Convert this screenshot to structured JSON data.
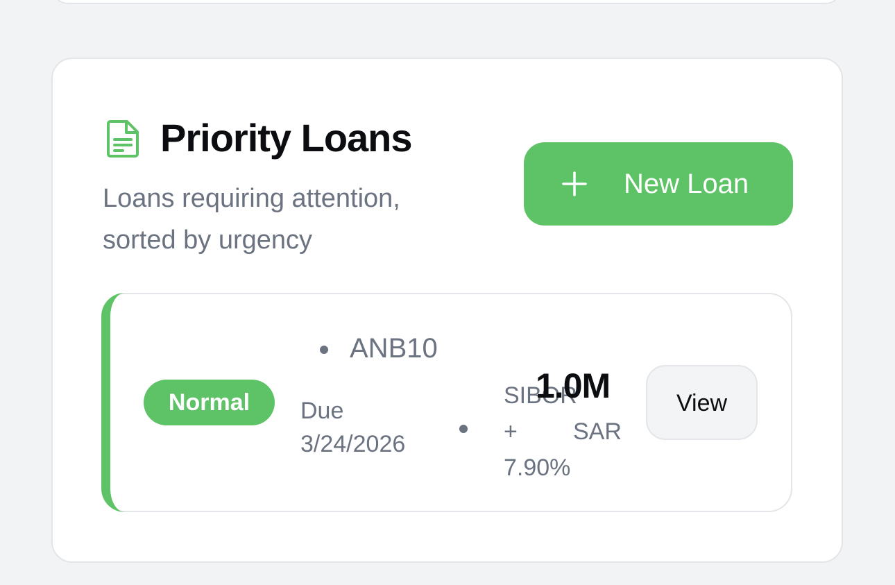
{
  "section": {
    "title": "Priority Loans",
    "subtitle": "Loans requiring attention, sorted by urgency",
    "icon": "document-icon",
    "new_loan_button": {
      "icon": "plus-icon",
      "label": "New Loan"
    }
  },
  "loans": [
    {
      "status": "Normal",
      "code": "ANB10",
      "due": "Due 3/24/2026",
      "rate": "SIBOR + 7.90%",
      "amount": "1.0M",
      "currency": "SAR",
      "view_label": "View"
    }
  ],
  "colors": {
    "accent": "#5ec366",
    "muted_text": "#6b7280",
    "page_background": "#f2f3f5"
  }
}
